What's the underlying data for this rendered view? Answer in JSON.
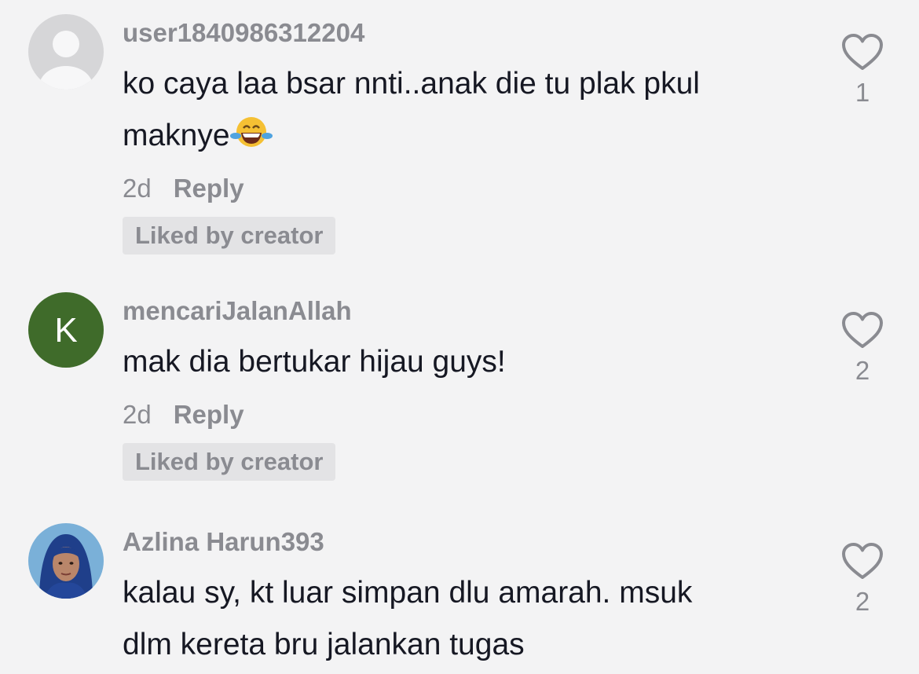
{
  "comments": [
    {
      "username": "user1840986312204",
      "text_lines": [
        "ko caya laa bsar nnti..anak die tu plak pkul",
        "maknye"
      ],
      "emoji": "face-with-tears-of-joy",
      "time": "2d",
      "reply_label": "Reply",
      "badge": "Liked by creator",
      "likes": "1",
      "avatar": {
        "type": "default-silhouette",
        "bg": "#d6d6d8"
      }
    },
    {
      "username": "mencariJalanAllah",
      "text_lines": [
        "mak dia bertukar hijau guys!"
      ],
      "time": "2d",
      "reply_label": "Reply",
      "badge": "Liked by creator",
      "likes": "2",
      "avatar": {
        "type": "letter",
        "letter": "K",
        "bg": "#3f6b2a"
      }
    },
    {
      "username": "Azlina Harun393",
      "text_lines": [
        "kalau sy, kt luar simpan dlu amarah. msuk",
        "dlm kereta bru jalankan tugas"
      ],
      "likes": "2",
      "avatar": {
        "type": "photo",
        "bg": "#7ab0d8"
      }
    }
  ],
  "colors": {
    "background": "#f3f3f4",
    "text": "#161823",
    "secondary": "#8a8b91",
    "badge_bg": "#e3e3e5"
  }
}
